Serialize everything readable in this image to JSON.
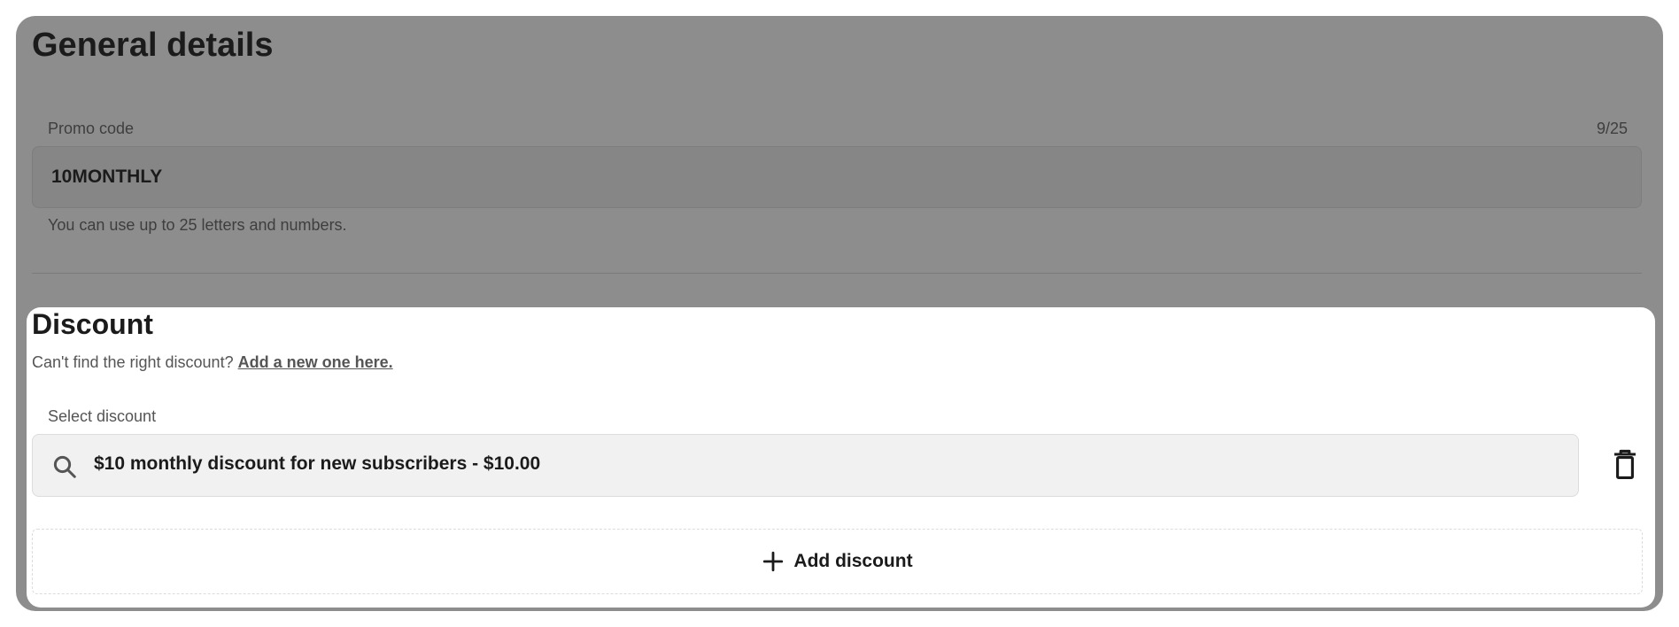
{
  "general": {
    "title": "General details",
    "promo_label": "Promo code",
    "promo_count": "9/25",
    "promo_value": "10MONTHLY",
    "promo_help": "You can use up to 25 letters and numbers."
  },
  "discount": {
    "title": "Discount",
    "helper_text": "Can't find the right discount?",
    "helper_link": "Add a new one here.",
    "select_label": "Select discount",
    "selected_value": "$10 monthly discount for new subscribers - $10.00",
    "add_button": "Add discount",
    "icons": {
      "search": "search-icon",
      "delete": "trash-icon",
      "add": "plus-icon"
    }
  },
  "colors": {
    "overlay": "#8d8d8d",
    "panel": "#ffffff",
    "field_bg": "#f1f1f1",
    "text": "#1b1b1b"
  }
}
